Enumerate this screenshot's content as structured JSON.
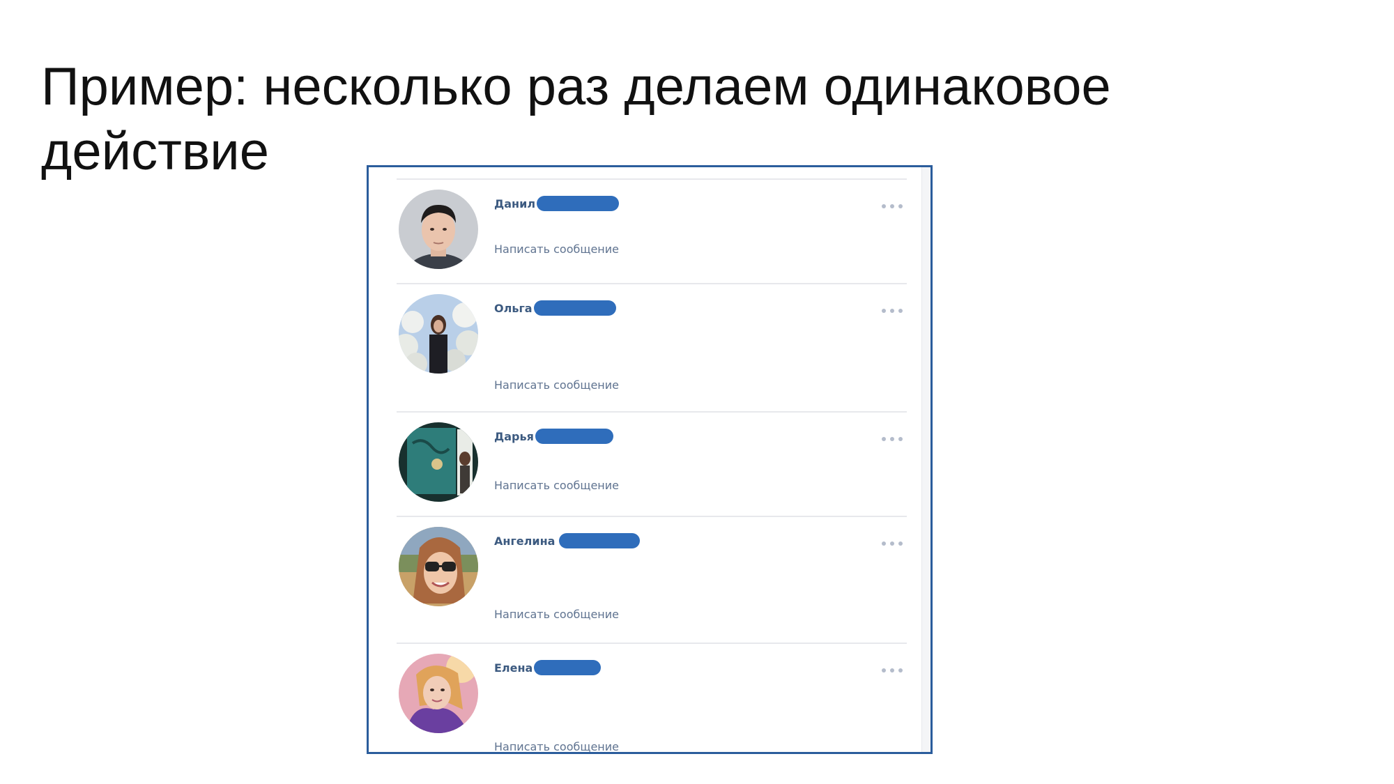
{
  "slide": {
    "title": "Пример: несколько раз делаем одинаковое действие"
  },
  "friends": [
    {
      "name": "Данил",
      "action": "Написать сообщение"
    },
    {
      "name": "Ольга",
      "action": "Написать сообщение"
    },
    {
      "name": "Дарья",
      "action": "Написать сообщение"
    },
    {
      "name": "Ангелина",
      "action": "Написать сообщение"
    },
    {
      "name": "Елена",
      "action": "Написать сообщение"
    }
  ],
  "colors": {
    "frame_border": "#2b5d9c",
    "redaction": "#2f6dbb",
    "name_text": "#3c5a80",
    "action_text": "#5f7390"
  },
  "icons": [
    "more-options-icon",
    "avatar-photo"
  ]
}
